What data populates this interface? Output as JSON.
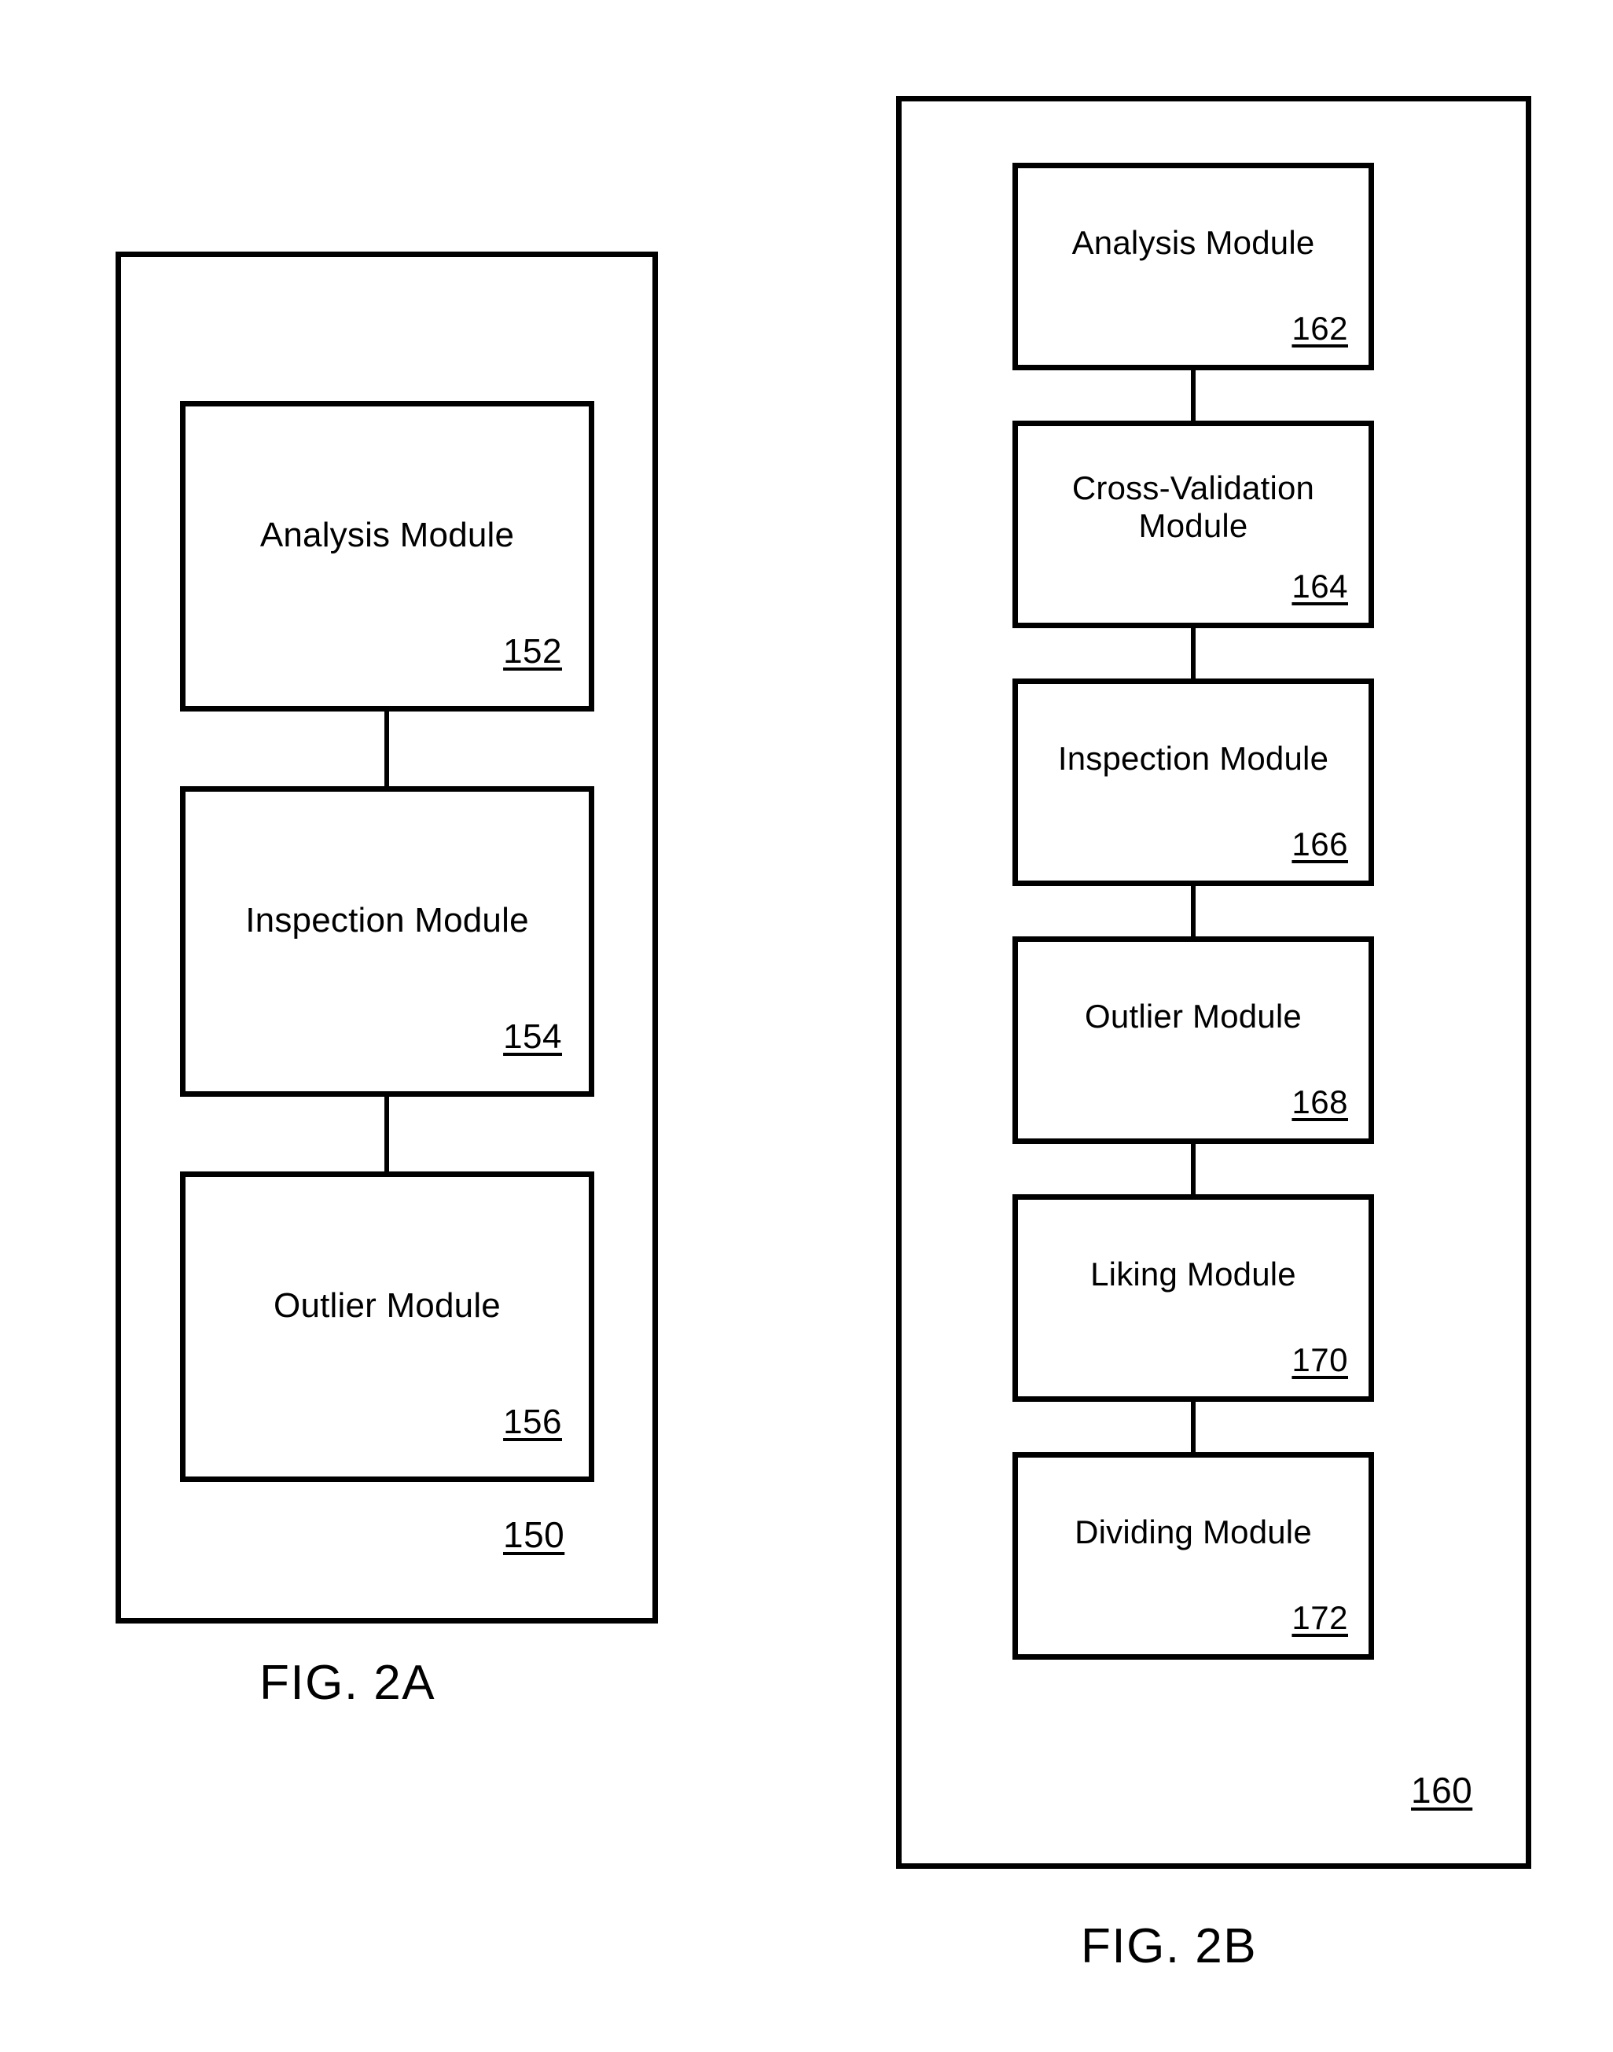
{
  "figures": [
    {
      "id": "fig-2a",
      "caption": "FIG. 2A",
      "container": {
        "ref": "150",
        "name": "system-container-150"
      },
      "modules": [
        {
          "label": "Analysis Module",
          "ref": "152"
        },
        {
          "label": "Inspection Module",
          "ref": "154"
        },
        {
          "label": "Outlier Module",
          "ref": "156"
        }
      ]
    },
    {
      "id": "fig-2b",
      "caption": "FIG. 2B",
      "container": {
        "ref": "160",
        "name": "system-container-160"
      },
      "modules": [
        {
          "label": "Analysis Module",
          "ref": "162"
        },
        {
          "label": "Cross-Validation\nModule",
          "ref": "164"
        },
        {
          "label": "Inspection Module",
          "ref": "166"
        },
        {
          "label": "Outlier Module",
          "ref": "168"
        },
        {
          "label": "Liking Module",
          "ref": "170"
        },
        {
          "label": "Dividing Module",
          "ref": "172"
        }
      ]
    }
  ],
  "colors": {
    "line": "#000000",
    "background": "#ffffff",
    "text": "#000000"
  }
}
